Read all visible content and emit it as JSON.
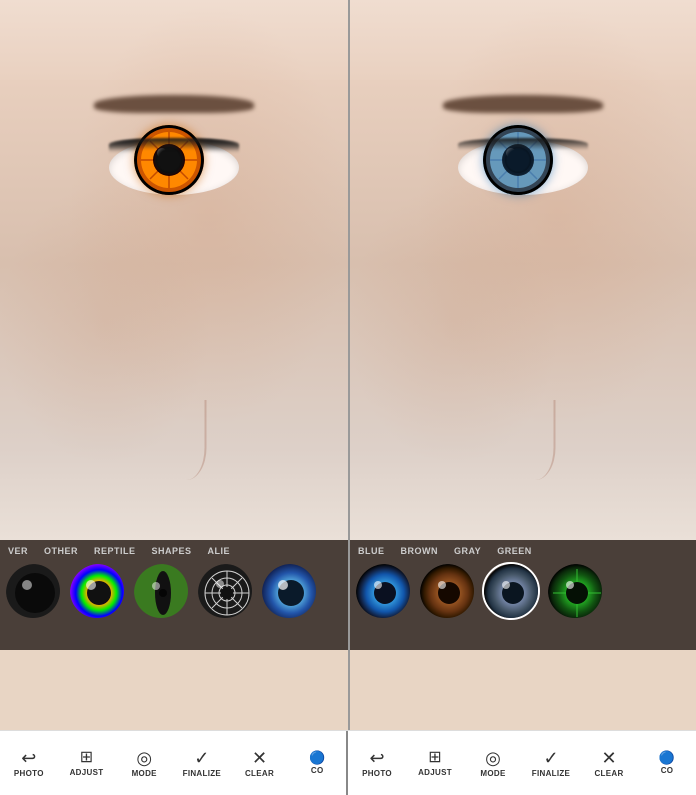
{
  "panels": [
    {
      "id": "left-panel",
      "lens_type": "orange",
      "categories": [
        "VER",
        "OTHER",
        "REPTILE",
        "SHAPES",
        "ALIE"
      ],
      "lenses": [
        {
          "type": "black",
          "label": ""
        },
        {
          "type": "rainbow",
          "label": ""
        },
        {
          "type": "reptile",
          "label": ""
        },
        {
          "type": "spiderweb",
          "label": ""
        },
        {
          "type": "alien-blue",
          "label": ""
        }
      ]
    },
    {
      "id": "right-panel",
      "lens_type": "blue",
      "categories": [
        "BLUE",
        "BROWN",
        "GRAY",
        "GREEN"
      ],
      "lenses": [
        {
          "type": "blue-lens",
          "label": ""
        },
        {
          "type": "brown-lens",
          "label": ""
        },
        {
          "type": "gray-lens",
          "label": "selected"
        },
        {
          "type": "green-lens",
          "label": ""
        }
      ]
    }
  ],
  "toolbar": {
    "items": [
      {
        "icon": "↩",
        "label": "PHOTO"
      },
      {
        "icon": "⊞",
        "label": "ADJUST"
      },
      {
        "icon": "◎",
        "label": "MODE"
      },
      {
        "icon": "✓",
        "label": "FINALIZE"
      },
      {
        "icon": "✕",
        "label": "CLEAR"
      },
      {
        "icon": "C",
        "label": "CO"
      }
    ]
  }
}
